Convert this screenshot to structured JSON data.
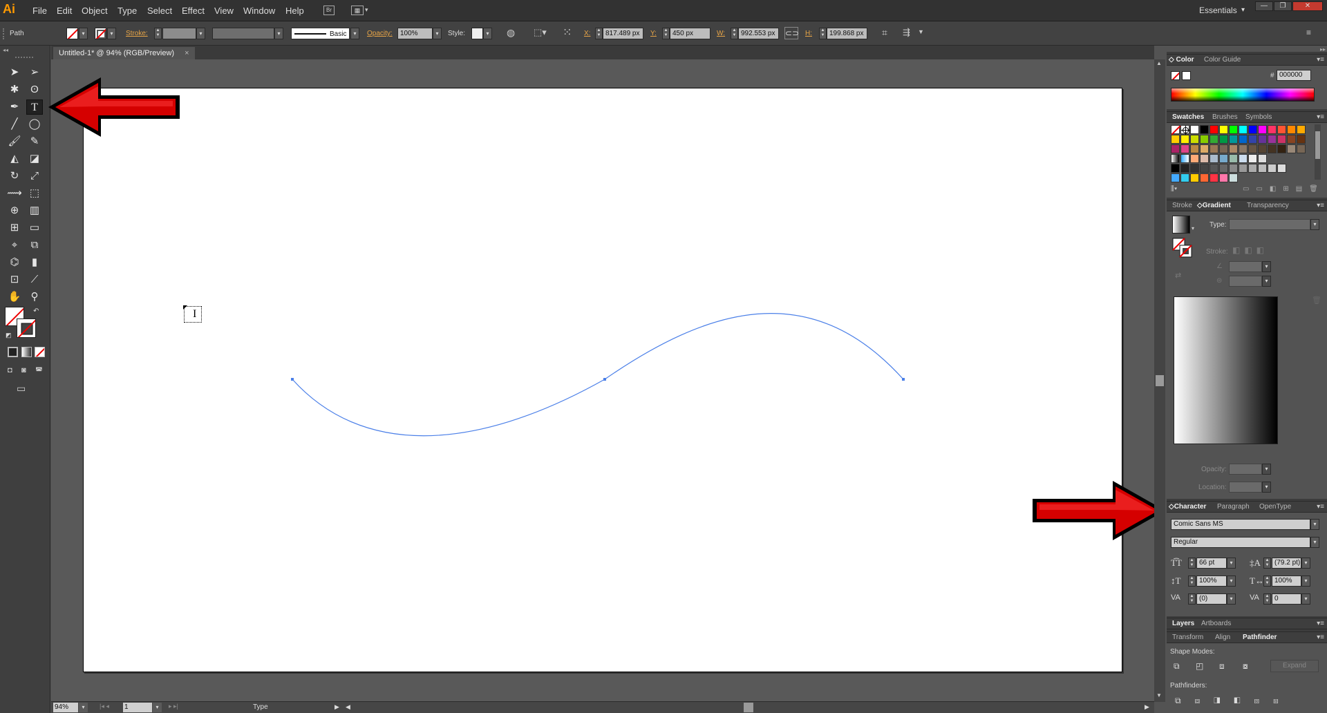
{
  "app": {
    "logo": "Ai",
    "workspace": "Essentials",
    "workspace_arrow": "▾"
  },
  "menubar": {
    "items": [
      "File",
      "Edit",
      "Object",
      "Type",
      "Select",
      "Effect",
      "View",
      "Window",
      "Help"
    ]
  },
  "window_controls": {
    "minimize": "—",
    "restore": "❐",
    "close": "✕"
  },
  "control_bar": {
    "selection": "Path",
    "stroke_label": "Stroke:",
    "stroke_style": "Basic",
    "opacity_label": "Opacity:",
    "opacity_value": "100%",
    "style_label": "Style:",
    "x_label": "X:",
    "x_value": "817.489 px",
    "y_label": "Y:",
    "y_value": "450 px",
    "w_label": "W:",
    "w_value": "992.553 px",
    "h_label": "H:",
    "h_value": "199.868 px"
  },
  "document": {
    "tab_title": "Untitled-1* @ 94% (RGB/Preview)",
    "close_glyph": "×"
  },
  "status_bar": {
    "zoom": "94%",
    "artboard_number": "1",
    "tool_name": "Type"
  },
  "panels": {
    "color": {
      "tabs": [
        "Color",
        "Color Guide"
      ],
      "hex_prefix": "#",
      "hex_value": "000000"
    },
    "swatches": {
      "tabs": [
        "Swatches",
        "Brushes",
        "Symbols"
      ]
    },
    "gradient": {
      "tabs": [
        "Stroke",
        "Gradient",
        "Transparency"
      ],
      "type_label": "Type:",
      "stroke_label": "Stroke:",
      "opacity_label": "Opacity:",
      "location_label": "Location:"
    },
    "character": {
      "tabs": [
        "Character",
        "Paragraph",
        "OpenType"
      ],
      "font_family": "Comic Sans MS",
      "font_style": "Regular",
      "font_size": "66 pt",
      "leading": "(79.2 pt)",
      "vertical_scale": "100%",
      "horizontal_scale": "100%",
      "kerning": "(0)",
      "tracking": "0"
    },
    "layers": {
      "tabs": [
        "Layers",
        "Artboards"
      ]
    },
    "pathfinder": {
      "tabs": [
        "Transform",
        "Align",
        "Pathfinder"
      ],
      "shape_modes_label": "Shape Modes:",
      "expand_label": "Expand",
      "pathfinders_label": "Pathfinders:"
    }
  },
  "colors": {
    "accent": "#e8a547",
    "path_stroke": "#4a7fe8",
    "arrow_red": "#d50000",
    "logo": "#ff9a00"
  },
  "icons": {
    "selection": "arrow-icon",
    "type_tool": "type-icon",
    "pen": "pen-icon",
    "hand": "hand-icon",
    "zoom": "zoom-icon"
  }
}
